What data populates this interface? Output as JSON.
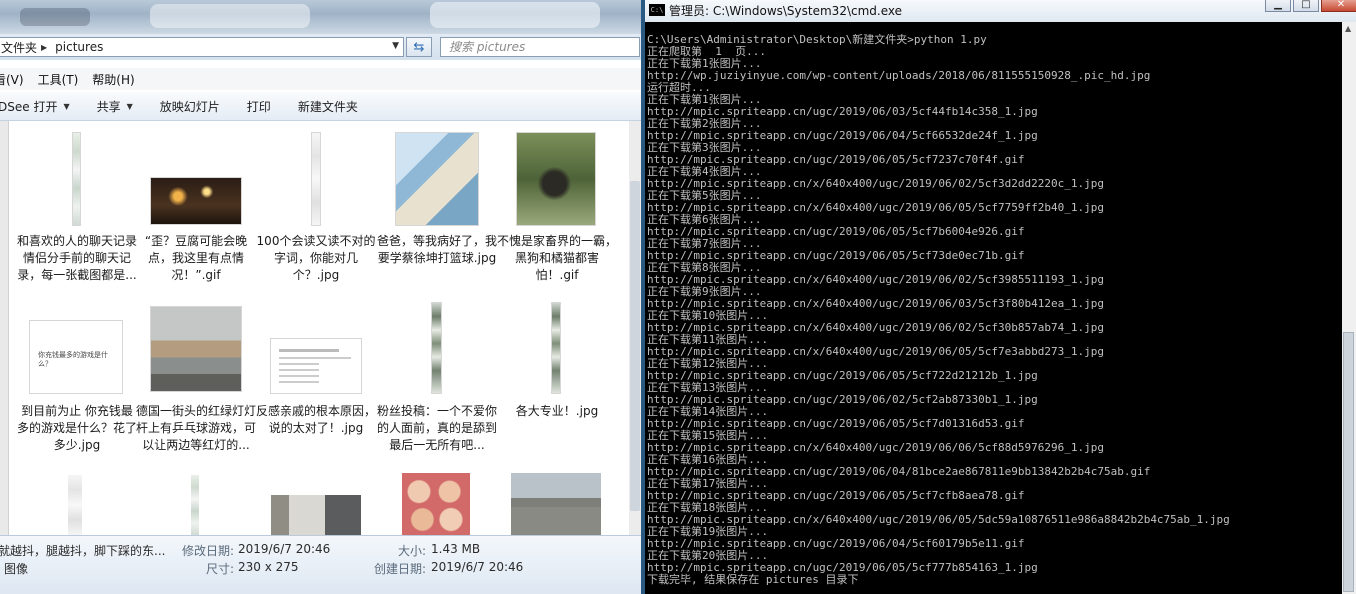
{
  "explorer": {
    "address": {
      "segments": [
        "文件夹",
        "pictures"
      ]
    },
    "search_placeholder": "搜索 pictures",
    "menu": [
      "看(V)",
      "工具(T)",
      "帮助(H)"
    ],
    "toolbar": [
      {
        "label": "DSee 打开",
        "dropdown": true
      },
      {
        "label": "共享",
        "dropdown": true
      },
      {
        "label": "放映幻灯片",
        "dropdown": false
      },
      {
        "label": "打印",
        "dropdown": false
      },
      {
        "label": "新建文件夹",
        "dropdown": false
      }
    ],
    "files": [
      {
        "name": "和喜欢的人的聊天记录情侣分手前的聊天记录，每一张截图都是...",
        "thumb": "strip"
      },
      {
        "name": "“歪？豆腐可能会晚点，我这里有点情况！”.gif",
        "thumb": "night"
      },
      {
        "name": "100个会读又读不对的字词，你能对几个？.jpg",
        "thumb": "strip-pale"
      },
      {
        "name": "爸爸，等我病好了，我要学蔡徐坤打篮球.jpg",
        "thumb": "comic"
      },
      {
        "name": "不愧是家畜界的一霸，黑狗和橘猫都害怕！.gif",
        "thumb": "dog"
      },
      {
        "name": "到目前为止 你充钱最多的游戏是什么？花了多少.jpg",
        "thumb": "white-card",
        "thumb_text": "你充钱最多的游戏是什么？"
      },
      {
        "name": "德国一街头的红绿灯灯杆上有乒乓球游戏，可以让两边等红灯的...",
        "thumb": "street"
      },
      {
        "name": "反感亲戚的根本原因，说的太对了！.jpg",
        "thumb": "doc"
      },
      {
        "name": "粉丝投稿：一个不爱你的人面前，真的是舔到最后一无所有吧...",
        "thumb": "strip-dark"
      },
      {
        "name": "各大专业！.jpg",
        "thumb": "strip-dark"
      }
    ],
    "details": {
      "file_name": "就越抖，腿越抖，脚下踩的东...",
      "file_type": "图像",
      "modified_label": "修改日期:",
      "modified_value": "2019/6/7 20:46",
      "size_label": "大小:",
      "size_value": "1.43 MB",
      "dimensions_label": "尺寸:",
      "dimensions_value": "230 x 275",
      "created_label": "创建日期:",
      "created_value": "2019/6/7 20:46"
    }
  },
  "cmd": {
    "title": "管理员: C:\\Windows\\System32\\cmd.exe",
    "icon_text": "C:\\",
    "lines": [
      "C:\\Users\\Administrator\\Desktop\\新建文件夹>python 1.py",
      "正在爬取第  1  页...",
      "正在下载第1张图片...",
      "http://wp.juziyinyue.com/wp-content/uploads/2018/06/811555150928_.pic_hd.jpg",
      "运行超时...",
      "正在下载第1张图片...",
      "http://mpic.spriteapp.cn/ugc/2019/06/03/5cf44fb14c358_1.jpg",
      "正在下载第2张图片...",
      "http://mpic.spriteapp.cn/ugc/2019/06/04/5cf66532de24f_1.jpg",
      "正在下载第3张图片...",
      "http://mpic.spriteapp.cn/ugc/2019/06/05/5cf7237c70f4f.gif",
      "正在下载第4张图片...",
      "http://mpic.spriteapp.cn/x/640x400/ugc/2019/06/02/5cf3d2dd2220c_1.jpg",
      "正在下载第5张图片...",
      "http://mpic.spriteapp.cn/x/640x400/ugc/2019/06/05/5cf7759ff2b40_1.jpg",
      "正在下载第6张图片...",
      "http://mpic.spriteapp.cn/ugc/2019/06/05/5cf7b6004e926.gif",
      "正在下载第7张图片...",
      "http://mpic.spriteapp.cn/ugc/2019/06/05/5cf73de0ec71b.gif",
      "正在下载第8张图片...",
      "http://mpic.spriteapp.cn/x/640x400/ugc/2019/06/02/5cf3985511193_1.jpg",
      "正在下载第9张图片...",
      "http://mpic.spriteapp.cn/x/640x400/ugc/2019/06/03/5cf3f80b412ea_1.jpg",
      "正在下载第10张图片...",
      "http://mpic.spriteapp.cn/x/640x400/ugc/2019/06/02/5cf30b857ab74_1.jpg",
      "正在下载第11张图片...",
      "http://mpic.spriteapp.cn/x/640x400/ugc/2019/06/05/5cf7e3abbd273_1.jpg",
      "正在下载第12张图片...",
      "http://mpic.spriteapp.cn/ugc/2019/06/05/5cf722d21212b_1.jpg",
      "正在下载第13张图片...",
      "http://mpic.spriteapp.cn/ugc/2019/06/02/5cf2ab87330b1_1.jpg",
      "正在下载第14张图片...",
      "http://mpic.spriteapp.cn/ugc/2019/06/05/5cf7d01316d53.gif",
      "正在下载第15张图片...",
      "http://mpic.spriteapp.cn/x/640x400/ugc/2019/06/06/5cf88d5976296_1.jpg",
      "正在下载第16张图片...",
      "http://mpic.spriteapp.cn/ugc/2019/06/04/81bce2ae867811e9bb13842b2b4c75ab.gif",
      "正在下载第17张图片...",
      "http://mpic.spriteapp.cn/ugc/2019/06/05/5cf7cfb8aea78.gif",
      "正在下载第18张图片...",
      "http://mpic.spriteapp.cn/x/640x400/ugc/2019/06/05/5dc59a10876511e986a8842b2b4c75ab_1.jpg",
      "正在下载第19张图片...",
      "http://mpic.spriteapp.cn/ugc/2019/06/04/5cf60179b5e11.gif",
      "正在下载第20张图片...",
      "http://mpic.spriteapp.cn/ugc/2019/06/05/5cf777b854163_1.jpg",
      "下载完毕, 结果保存在 pictures 目录下"
    ]
  }
}
